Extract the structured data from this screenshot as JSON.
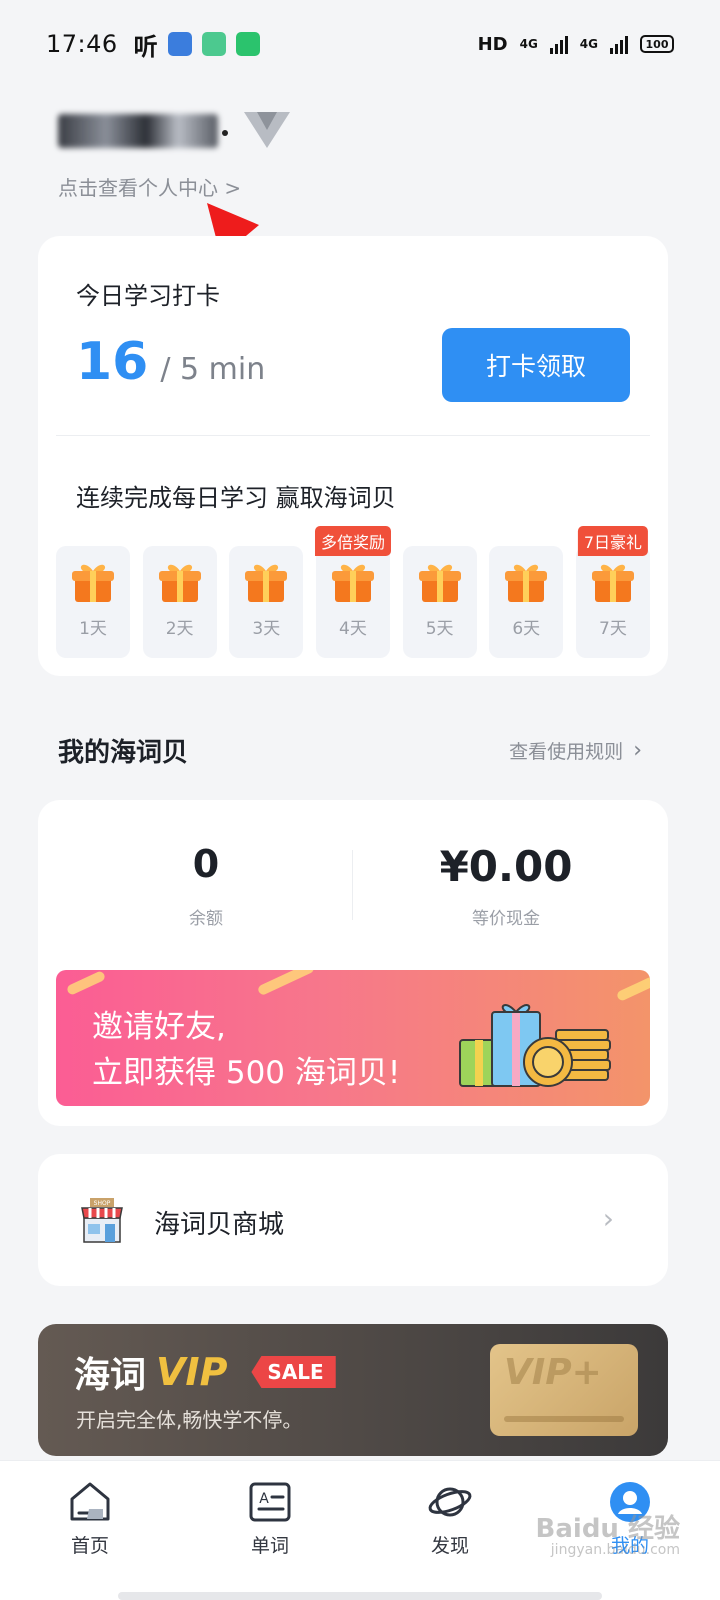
{
  "status_bar": {
    "time": "17:46",
    "listen_label": "听",
    "network_hd": "HD",
    "network_4g_a": "4G",
    "network_4g_b": "4G",
    "battery": "100"
  },
  "profile": {
    "link_text": "点击查看个人中心 >"
  },
  "checkin": {
    "title": "今日学习打卡",
    "minutes_done": "16",
    "goal": "/ 5 min",
    "button_label": "打卡领取",
    "streak_title": "连续完成每日学习 赢取海词贝",
    "days": [
      {
        "label": "1天",
        "tag": ""
      },
      {
        "label": "2天",
        "tag": ""
      },
      {
        "label": "3天",
        "tag": ""
      },
      {
        "label": "4天",
        "tag": "多倍奖励"
      },
      {
        "label": "5天",
        "tag": ""
      },
      {
        "label": "6天",
        "tag": ""
      },
      {
        "label": "7天",
        "tag": "7日豪礼"
      }
    ]
  },
  "shells": {
    "title": "我的海词贝",
    "rules_link": "查看使用规则",
    "balance_value": "0",
    "balance_label": "余额",
    "cash_value": "¥0.00",
    "cash_label": "等价现金",
    "invite_line1": "邀请好友,",
    "invite_line2": "立即获得 500 海词贝!"
  },
  "shop": {
    "label": "海词贝商城",
    "icon_text": "SHOP"
  },
  "vip_banner": {
    "brand": "海词",
    "vip_word": "VIP",
    "sale_tag": "SALE",
    "subtitle": "开启完全体,畅快学不停。",
    "card_text": "VIP+"
  },
  "bottom_nav": {
    "items": [
      {
        "label": "首页",
        "icon": "home-icon"
      },
      {
        "label": "单词",
        "icon": "word-card-icon"
      },
      {
        "label": "发现",
        "icon": "planet-icon"
      },
      {
        "label": "我的",
        "icon": "profile-icon"
      }
    ],
    "active_index": 3
  },
  "watermark": {
    "text": "Baidu 经验",
    "sub": "jingyan.baidu.com"
  },
  "colors": {
    "accent": "#2f8ff3",
    "tag_red": "#f0503a",
    "gift_orange": "#f4781e",
    "background": "#f4f5f7"
  }
}
